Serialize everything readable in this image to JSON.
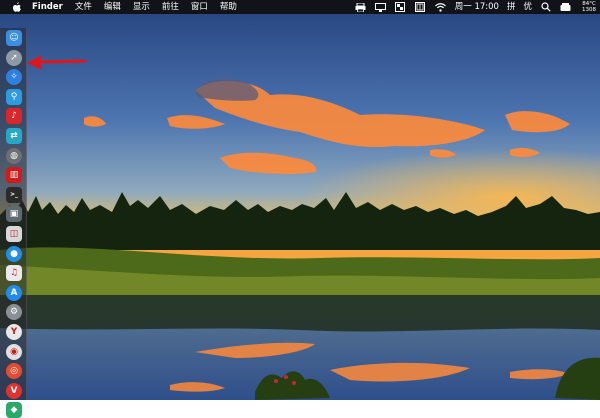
{
  "menubar": {
    "app_name": "Finder",
    "menus": [
      "文件",
      "编辑",
      "显示",
      "前往",
      "窗口",
      "帮助"
    ],
    "status": {
      "clock": "周一 17:00",
      "input_method": "拼",
      "ime_label": "优",
      "temperature": "84°C",
      "temperature_extra": "1308"
    }
  },
  "dock": {
    "items": [
      {
        "name": "finder",
        "icon": "finder-icon",
        "color": "#3b8fe3"
      },
      {
        "name": "launchpad",
        "icon": "rocket-icon",
        "color": "#8e9aa5"
      },
      {
        "name": "safari",
        "icon": "compass-icon",
        "color": "#2e7fe0"
      },
      {
        "name": "photo-booth",
        "icon": "magnifier-icon",
        "color": "#2c9be0"
      },
      {
        "name": "netease-music",
        "icon": "music-note-icon",
        "color": "#d8262a"
      },
      {
        "name": "migration",
        "icon": "migrate-icon",
        "color": "#29a7c7"
      },
      {
        "name": "earth",
        "icon": "globe-icon",
        "color": "#6c6f73"
      },
      {
        "name": "red-app",
        "icon": "red-app-icon",
        "color": "#cf1b1b"
      },
      {
        "name": "terminal",
        "icon": "terminal-icon",
        "color": "#2a2a2a"
      },
      {
        "name": "photos-preview",
        "icon": "picture-icon",
        "color": "#5f6a72"
      },
      {
        "name": "preview",
        "icon": "preview-icon",
        "color": "#d6d8da"
      },
      {
        "name": "siri",
        "icon": "microphone-icon",
        "color": "#1f8fe6"
      },
      {
        "name": "itunes",
        "icon": "music-icon",
        "color": "#e9e9ee"
      },
      {
        "name": "app-store",
        "icon": "app-store-icon",
        "color": "#1d8cf0"
      },
      {
        "name": "system-preferences",
        "icon": "gear-icon",
        "color": "#8a8f96"
      },
      {
        "name": "yandex",
        "icon": "y-icon",
        "color": "#e8e8e8"
      },
      {
        "name": "chrome",
        "icon": "chrome-icon",
        "color": "#e0e0e0"
      },
      {
        "name": "weibo",
        "icon": "weibo-icon",
        "color": "#e54b2f"
      },
      {
        "name": "vivaldi",
        "icon": "v-icon",
        "color": "#e3312b"
      },
      {
        "name": "green-app",
        "icon": "green-app-icon",
        "color": "#2aa96b"
      }
    ]
  },
  "annotation": {
    "arrow_color": "#e0161c"
  }
}
